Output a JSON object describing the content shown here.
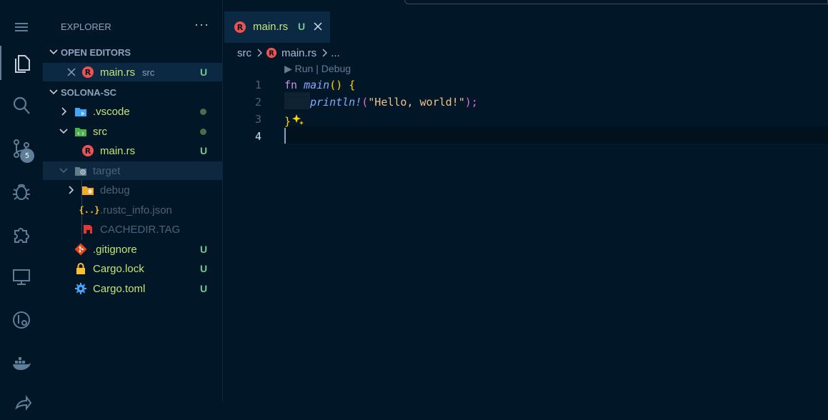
{
  "activity_bar": {
    "items": [
      "explorer-icon",
      "search-icon",
      "source-control-icon",
      "debug-icon",
      "extensions-icon",
      "remote-explorer-icon",
      "testing-icon",
      "docker-icon",
      "share-icon"
    ],
    "scm_badge": "5"
  },
  "explorer": {
    "title": "EXPLORER",
    "more": "···",
    "open_editors": {
      "label": "OPEN EDITORS",
      "items": [
        {
          "name": "main.rs",
          "folder": "src",
          "status": "U"
        }
      ]
    },
    "workspace": {
      "label": "SOLONA-SC",
      "vscode": ".vscode",
      "src": "src",
      "src_main": "main.rs",
      "target": "target",
      "debug": "debug",
      "rustc_info": ".rustc_info.json",
      "cachedir": "CACHEDIR.TAG",
      "gitignore": ".gitignore",
      "cargo_lock": "Cargo.lock",
      "cargo_toml": "Cargo.toml",
      "untracked": "U"
    }
  },
  "tab": {
    "name": "main.rs",
    "status": "U"
  },
  "breadcrumb": {
    "folder": "src",
    "file": "main.rs",
    "more": "..."
  },
  "editor": {
    "codelens": "▶ Run | Debug",
    "line_numbers": [
      "1",
      "2",
      "3",
      "4"
    ],
    "lines": {
      "l1_kw": "fn",
      "l1_fn": "main",
      "l1_rest": "() {",
      "l2_macro": "println!",
      "l2_open": "(",
      "l2_str": "\"Hello, world!\"",
      "l2_close": ");",
      "l3_brace": "}"
    }
  },
  "colors": {
    "background": "#011627",
    "git_untracked": "#73c991",
    "rust_icon": "#ef5350",
    "folder_blue": "#42a5f5",
    "folder_green": "#4caf50"
  }
}
